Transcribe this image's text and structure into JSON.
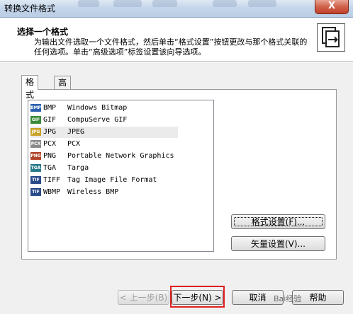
{
  "window": {
    "title": "转换文件格式",
    "close_glyph": "X"
  },
  "header": {
    "title": "选择一个格式",
    "description": "为输出文件选取一个文件格式，然后单击“格式设置”按钮更改与那个格式关联的任何选项。单击“高级选项”标签设置该向导选项。",
    "icon": "convert-files-icon"
  },
  "tabs": [
    {
      "label": "格式",
      "active": true
    },
    {
      "label": "高级选项",
      "active": false
    }
  ],
  "formats": [
    {
      "ext": "BMP",
      "desc": "Windows Bitmap",
      "icon": "BMP",
      "color": "#2a5fb0",
      "selected": false
    },
    {
      "ext": "GIF",
      "desc": "CompuServe GIF",
      "icon": "GIF",
      "color": "#3a8a3a",
      "selected": false
    },
    {
      "ext": "JPG",
      "desc": "JPEG",
      "icon": "JPG",
      "color": "#c9a227",
      "selected": true
    },
    {
      "ext": "PCX",
      "desc": "PCX",
      "icon": "PCX",
      "color": "#8a8a8a",
      "selected": false
    },
    {
      "ext": "PNG",
      "desc": "Portable Network Graphics",
      "icon": "PNG",
      "color": "#b0452a",
      "selected": false
    },
    {
      "ext": "TGA",
      "desc": "Targa",
      "icon": "TGA",
      "color": "#2a7a8a",
      "selected": false
    },
    {
      "ext": "TIFF",
      "desc": "Tag Image File Format",
      "icon": "TIF",
      "color": "#2a4a8a",
      "selected": false
    },
    {
      "ext": "WBMP",
      "desc": "Wireless BMP",
      "icon": "TIF",
      "color": "#2a4a8a",
      "selected": false
    }
  ],
  "side_buttons": {
    "format_settings": "格式设置(F)...",
    "vector_settings": "矢量设置(V)..."
  },
  "footer": {
    "back": "< 上一步(B)",
    "next": "下一步(N) >",
    "cancel": "取消",
    "help": "帮助",
    "watermark": "Bai经验"
  }
}
